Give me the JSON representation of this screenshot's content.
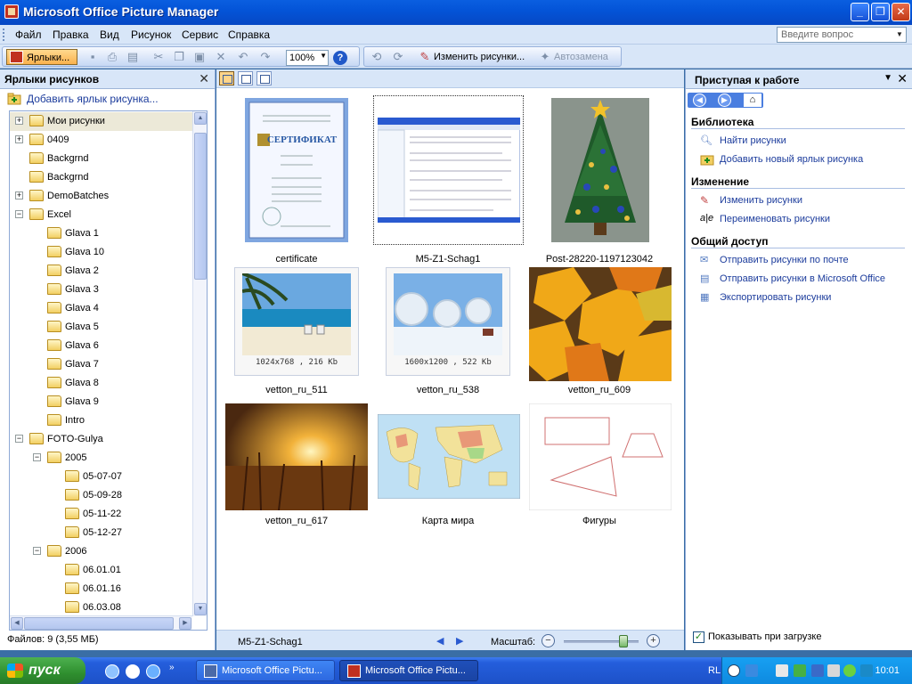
{
  "window": {
    "title": "Microsoft Office Picture Manager"
  },
  "menu": [
    "Файл",
    "Правка",
    "Вид",
    "Рисунок",
    "Сервис",
    "Справка"
  ],
  "help_box": {
    "placeholder": "Введите вопрос"
  },
  "toolbar": {
    "shortcuts_label": "Ярлыки...",
    "zoom_value": "100%",
    "edit_pictures_label": "Изменить рисунки...",
    "autocorrect_label": "Автозамена"
  },
  "left_pane": {
    "title": "Ярлыки рисунков",
    "add_shortcut": "Добавить ярлык рисунка...",
    "tree": [
      {
        "label": "Мои рисунки",
        "level": 0,
        "exp": "+",
        "sel": true
      },
      {
        "label": "0409",
        "level": 0,
        "exp": "+"
      },
      {
        "label": "Backgrnd",
        "level": 0,
        "exp": ""
      },
      {
        "label": "Backgrnd",
        "level": 0,
        "exp": ""
      },
      {
        "label": "DemoBatches",
        "level": 0,
        "exp": "+"
      },
      {
        "label": "Excel",
        "level": 0,
        "exp": "−"
      },
      {
        "label": "Glava 1",
        "level": 1,
        "exp": ""
      },
      {
        "label": "Glava 10",
        "level": 1,
        "exp": ""
      },
      {
        "label": "Glava 2",
        "level": 1,
        "exp": ""
      },
      {
        "label": "Glava 3",
        "level": 1,
        "exp": ""
      },
      {
        "label": "Glava 4",
        "level": 1,
        "exp": ""
      },
      {
        "label": "Glava 5",
        "level": 1,
        "exp": ""
      },
      {
        "label": "Glava 6",
        "level": 1,
        "exp": ""
      },
      {
        "label": "Glava 7",
        "level": 1,
        "exp": ""
      },
      {
        "label": "Glava 8",
        "level": 1,
        "exp": ""
      },
      {
        "label": "Glava 9",
        "level": 1,
        "exp": ""
      },
      {
        "label": "Intro",
        "level": 1,
        "exp": ""
      },
      {
        "label": "FOTO-Gulya",
        "level": 0,
        "exp": "−"
      },
      {
        "label": "2005",
        "level": 1,
        "exp": "−"
      },
      {
        "label": "05-07-07",
        "level": 2,
        "exp": ""
      },
      {
        "label": "05-09-28",
        "level": 2,
        "exp": ""
      },
      {
        "label": "05-11-22",
        "level": 2,
        "exp": ""
      },
      {
        "label": "05-12-27",
        "level": 2,
        "exp": ""
      },
      {
        "label": "2006",
        "level": 1,
        "exp": "−"
      },
      {
        "label": "06.01.01",
        "level": 2,
        "exp": ""
      },
      {
        "label": "06.01.16",
        "level": 2,
        "exp": ""
      },
      {
        "label": "06.03.08",
        "level": 2,
        "exp": ""
      }
    ],
    "file_count": "Файлов: 9 (3,55 МБ)"
  },
  "thumbnails": [
    {
      "name": "certificate",
      "kind": "certificate",
      "cert_text": "СЕРТИФИКАТ"
    },
    {
      "name": "M5-Z1-Schag1",
      "kind": "screenshot",
      "selected": true
    },
    {
      "name": "Post-28220-1197123042",
      "kind": "tree"
    },
    {
      "name": "vetton_ru_511",
      "kind": "beach",
      "info": "1024x768 , 216 Kb"
    },
    {
      "name": "vetton_ru_538",
      "kind": "snow",
      "info": "1600x1200 , 522 Kb"
    },
    {
      "name": "vetton_ru_609",
      "kind": "leaves"
    },
    {
      "name": "vetton_ru_617",
      "kind": "sunset"
    },
    {
      "name": "Карта мира",
      "kind": "map"
    },
    {
      "name": "Фигуры",
      "kind": "shapes"
    }
  ],
  "center_status": {
    "file": "M5-Z1-Schag1",
    "zoom_label": "Масштаб:",
    "zoom_level_fraction": 0.8
  },
  "right_pane": {
    "title": "Приступая к работе",
    "sections": [
      {
        "title": "Библиотека",
        "links": [
          "Найти рисунки",
          "Добавить новый ярлык рисунка"
        ]
      },
      {
        "title": "Изменение",
        "links": [
          "Изменить рисунки",
          "Переименовать рисунки"
        ]
      },
      {
        "title": "Общий доступ",
        "links": [
          "Отправить рисунки по почте",
          "Отправить рисунки в Microsoft Office",
          "Экспортировать рисунки"
        ]
      }
    ],
    "show_on_start": "Показывать при загрузке"
  },
  "taskbar": {
    "start": "пуск",
    "tasks": [
      "Microsoft Office Pictu...",
      "Microsoft Office Pictu..."
    ],
    "lang": "RL",
    "clock": "10:01"
  },
  "colors": {
    "titlebar": "#0454d8",
    "link": "#1c3c9c",
    "pane_bg": "#d8e6f8",
    "start": "#2f8f2f"
  }
}
